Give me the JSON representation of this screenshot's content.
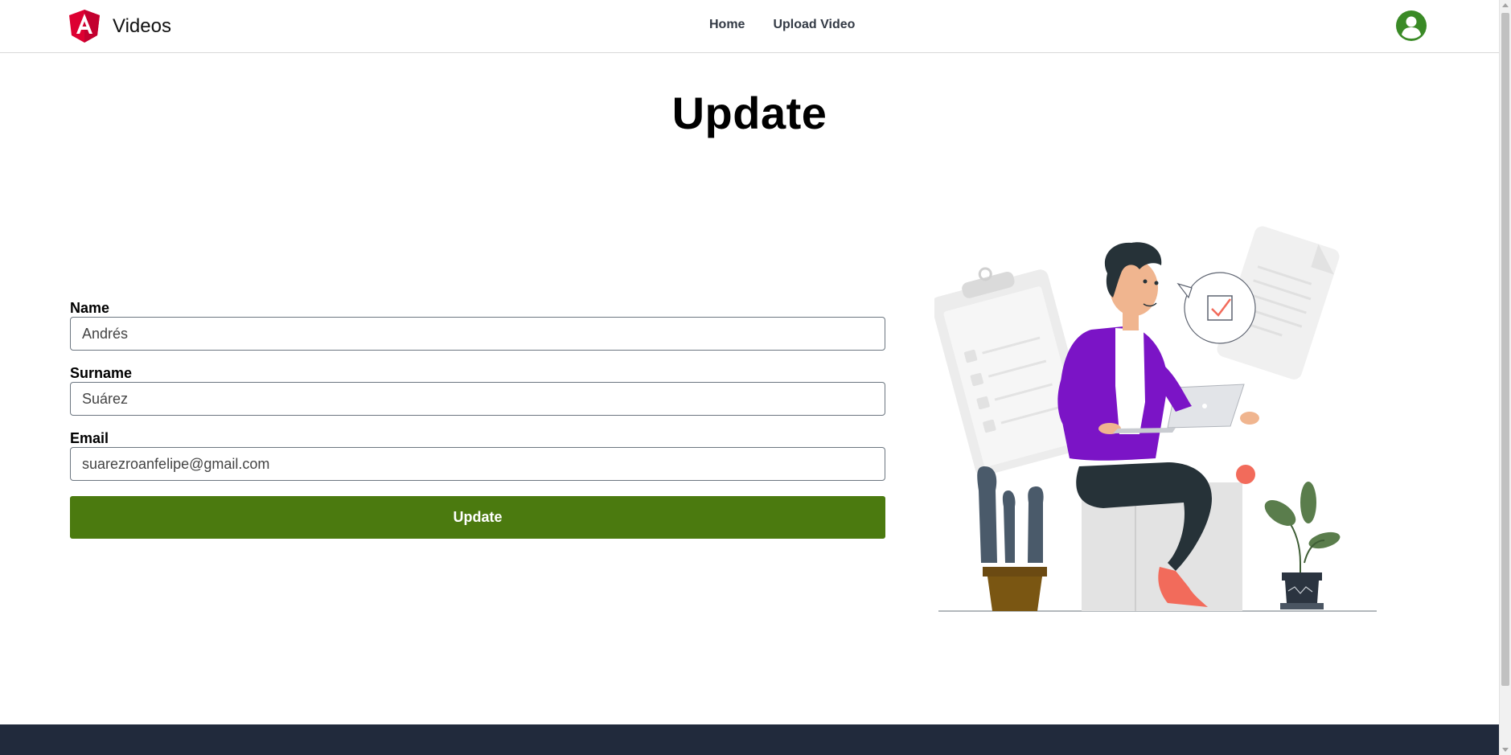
{
  "navbar": {
    "brand_title": "Videos",
    "links": [
      "Home",
      "Upload Video"
    ],
    "avatar_color": "#3a8a26"
  },
  "page": {
    "title": "Update"
  },
  "form": {
    "name_label": "Name",
    "name_value": "Andrés",
    "surname_label": "Surname",
    "surname_value": "Suárez",
    "email_label": "Email",
    "email_value": "suarezroanfelipe@gmail.com",
    "submit_label": "Update",
    "submit_color": "#4b7a0f"
  },
  "icons": {
    "logo": "angular-logo-icon",
    "avatar": "user-avatar-icon"
  },
  "footer_color": "#212a3c"
}
